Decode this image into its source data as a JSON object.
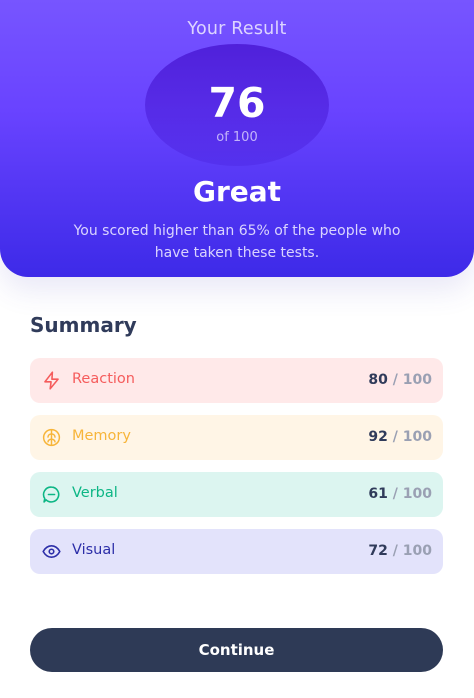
{
  "result": {
    "title": "Your Result",
    "score": "76",
    "score_of": "of 100",
    "grade": "Great",
    "message": "You scored higher than 65% of the people who have taken these tests."
  },
  "summary": {
    "title": "Summary",
    "items": [
      {
        "label": "Reaction",
        "score": "80",
        "separator": "/",
        "max": "100",
        "icon": "lightning-icon",
        "color": "#f55c5c",
        "bg": "#ffe9e9"
      },
      {
        "label": "Memory",
        "score": "92",
        "separator": "/",
        "max": "100",
        "icon": "brain-icon",
        "color": "#f7b53a",
        "bg": "#fff5e6"
      },
      {
        "label": "Verbal",
        "score": "61",
        "separator": "/",
        "max": "100",
        "icon": "chat-bubble-icon",
        "color": "#0db685",
        "bg": "#dcf5f0"
      },
      {
        "label": "Visual",
        "score": "72",
        "separator": "/",
        "max": "100",
        "icon": "eye-icon",
        "color": "#2c2ea8",
        "bg": "#e3e3fb"
      }
    ]
  },
  "continue_label": "Continue"
}
